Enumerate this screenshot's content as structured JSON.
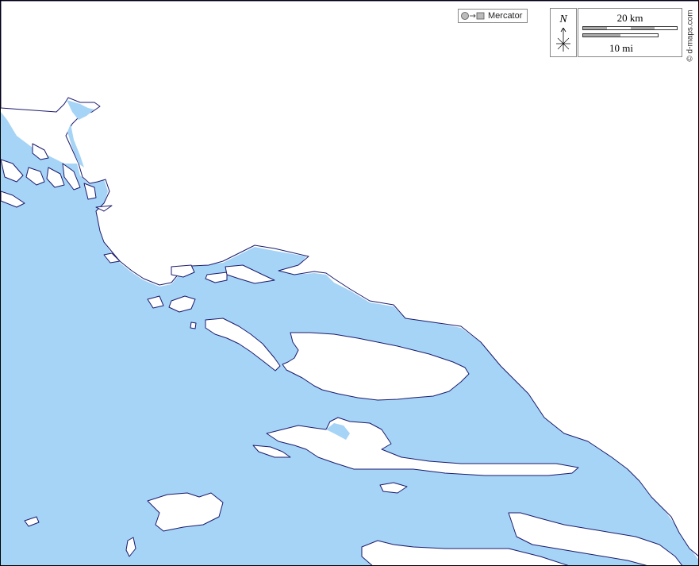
{
  "map": {
    "projection_label": "Mercator",
    "north_label": "N",
    "scale_km_label": "20 km",
    "scale_mi_label": "10 mi",
    "credit": "© d-maps.com",
    "colors": {
      "sea": "#a6d4f6",
      "land": "#ffffff",
      "coastline": "#1a1a6e"
    },
    "icons": {
      "projection": "globe-to-rectangle-icon",
      "north": "compass-rose-icon"
    }
  }
}
